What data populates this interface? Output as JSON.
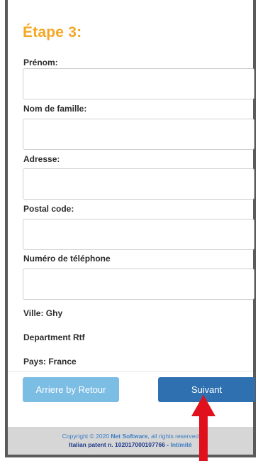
{
  "form": {
    "step_title": "Étape 3:",
    "fields": [
      {
        "label": "Prénom:",
        "value": ""
      },
      {
        "label": "Nom de famille:",
        "value": ""
      },
      {
        "label": "Adresse:",
        "value": ""
      },
      {
        "label": "Postal code:",
        "value": ""
      },
      {
        "label": "Numéro de téléphone",
        "value": ""
      }
    ],
    "info": {
      "city": "Ville: Ghy",
      "department": "Department Rtf",
      "country": "Pays: France"
    },
    "buttons": {
      "back_label": "Arriere by Retour",
      "next_label": "Suivant"
    }
  },
  "footer": {
    "copyright": "Copyright © 2020 ",
    "company": "Net Software",
    "rights": ", all rights reserved",
    "patent": "Italian patent n. 102017000107766 - ",
    "privacy_link": "Intimité"
  },
  "annotation": {
    "arrow_color": "#e0101c"
  }
}
